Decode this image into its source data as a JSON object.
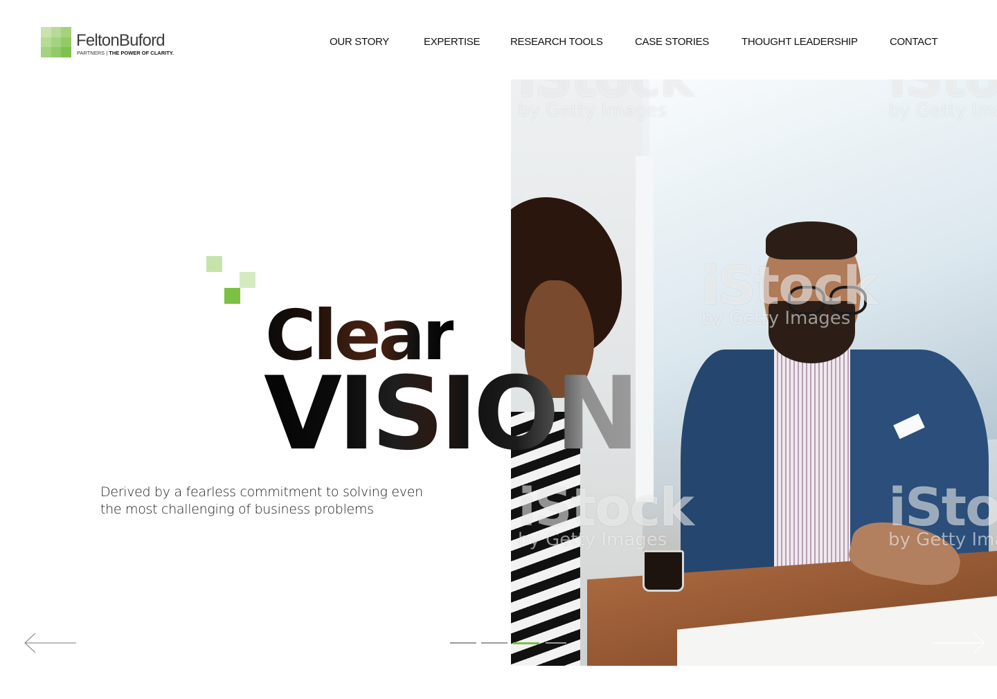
{
  "logo": {
    "name": "FeltonBuford",
    "tagline_prefix": "PARTNERS |",
    "tagline_bold": "THE POWER OF CLARITY.",
    "mark_colors": [
      "#cfe6b8",
      "#b6d995",
      "#8cc556"
    ]
  },
  "nav": {
    "items": [
      {
        "label": "OUR STORY"
      },
      {
        "label": "EXPERTISE"
      },
      {
        "label": "RESEARCH TOOLS"
      },
      {
        "label": "CASE STORIES"
      },
      {
        "label": "THOUGHT LEADERSHIP"
      },
      {
        "label": "CONTACT"
      }
    ]
  },
  "hero": {
    "headline_small": "Clear",
    "headline_big": "VISION",
    "subtext": "Derived by a fearless commitment to solving even the most challenging of business problems",
    "accent_color": "#7cc142",
    "deco_colors": [
      "#c8e2ab",
      "#d6eac0",
      "#7cc142"
    ],
    "watermark": {
      "big": "iStock",
      "small": "by Getty Images"
    }
  },
  "slider": {
    "prev_icon": "arrow-left-icon",
    "next_icon": "arrow-right-icon",
    "slide_count": 4,
    "active_slide": 3
  }
}
